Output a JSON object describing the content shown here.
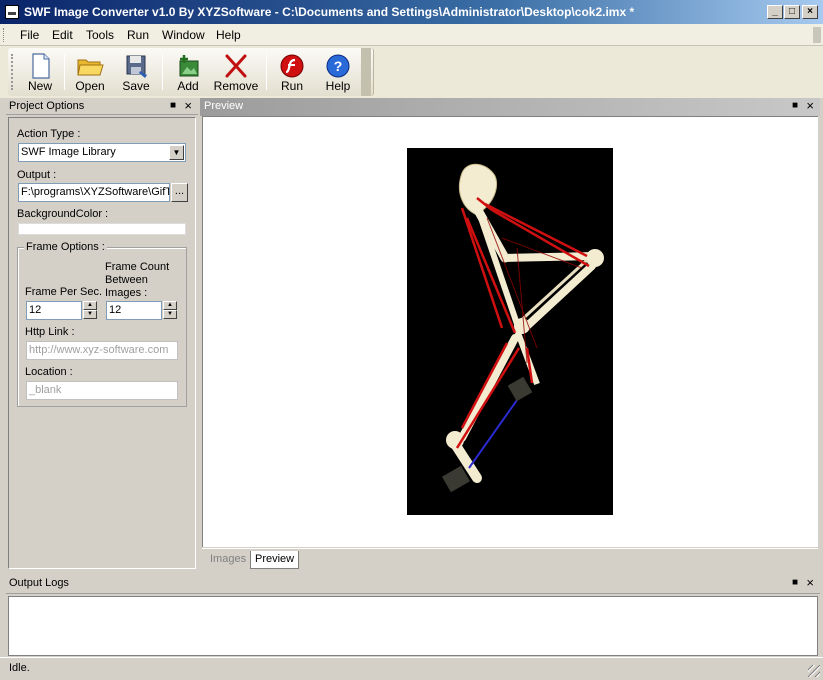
{
  "window": {
    "title": "SWF Image Converter v1.0 By XYZSoftware - C:\\Documents and Settings\\Administrator\\Desktop\\cok2.imx *"
  },
  "menu": {
    "items": [
      "File",
      "Edit",
      "Tools",
      "Run",
      "Window",
      "Help"
    ]
  },
  "toolbar": {
    "new": "New",
    "open": "Open",
    "save": "Save",
    "add": "Add",
    "remove": "Remove",
    "run": "Run",
    "help": "Help"
  },
  "project_options": {
    "title": "Project Options",
    "action_type_label": "Action Type :",
    "action_type_value": "SWF Image Library",
    "output_label": "Output :",
    "output_value": "F:\\programs\\XYZSoftware\\GifT",
    "browse_label": "...",
    "bgcolor_label": "BackgroundColor :",
    "frame_options": {
      "title": "Frame Options :",
      "fps_label": "Frame Per Sec.",
      "fps_value": "12",
      "frame_count_label": "Frame Count Between Images :",
      "frame_count_value": "12",
      "http_label": "Http Link :",
      "http_placeholder": "http://www.xyz-software.com",
      "location_label": "Location :",
      "location_placeholder": "_blank"
    }
  },
  "preview": {
    "title": "Preview",
    "tabs": [
      "Images",
      "Preview"
    ],
    "active_tab": "Preview"
  },
  "output_logs": {
    "title": "Output Logs"
  },
  "status": {
    "text": "Idle."
  }
}
